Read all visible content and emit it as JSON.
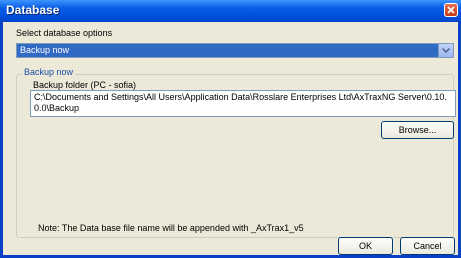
{
  "window": {
    "title": "Database"
  },
  "options": {
    "label": "Select database options",
    "selected": "Backup now"
  },
  "group": {
    "title": "Backup now",
    "folder_label": "Backup folder (PC - sofia)",
    "folder_path": "C:\\Documents and Settings\\All Users\\Application Data\\Rosslare Enterprises Ltd\\AxTraxNG Server\\0.10.0.0\\Backup",
    "browse_label": "Browse..."
  },
  "note": "Note: The Data base file name will be appended with _AxTrax1_v5",
  "buttons": {
    "ok": "OK",
    "cancel": "Cancel"
  },
  "colors": {
    "titlebar": "#0054e3",
    "selection": "#316ac5",
    "window_bg": "#ece9d8"
  }
}
